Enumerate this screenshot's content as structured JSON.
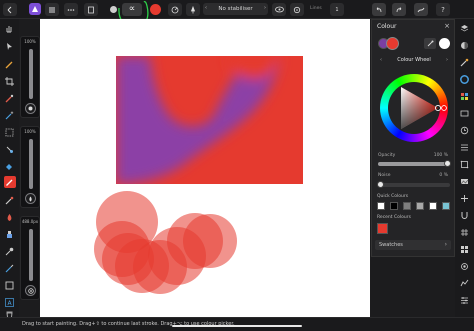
{
  "toolbar": {
    "stabiliser_label": "No stabiliser",
    "lines_label": "Lines",
    "lines_value": "1"
  },
  "left_panels": {
    "size_value": "100%",
    "opacity_value": "100%",
    "flow_value": "488.0px"
  },
  "colour_panel": {
    "title": "Colour",
    "mode_label": "Colour Wheel",
    "opacity_label": "Opacity",
    "opacity_value": "100 %",
    "opacity_level": 1.0,
    "noise_label": "Noise",
    "noise_value": "0 %",
    "noise_level": 0.0,
    "quick_colours_label": "Quick Colours",
    "quick_colours": [
      "#ffffff",
      "#000000",
      "#7f7f7f",
      "#a8a8a8",
      "#ffffff",
      "#79c3d2"
    ],
    "recent_colours_label": "Recent Colours",
    "recent_colours": [
      "#e53a2f"
    ],
    "swatches_label": "Swatches",
    "primary_colour": "#e53a2f",
    "secondary_colour": "#7a3fa3"
  },
  "status": {
    "message": "Drag to start painting. Drag+⇧ to continue last stroke. Drag+⌥ to use colour picker."
  },
  "colors": {
    "accent": "#e53a2f",
    "purple": "#8c3fa6",
    "panel_bg": "#242426"
  }
}
